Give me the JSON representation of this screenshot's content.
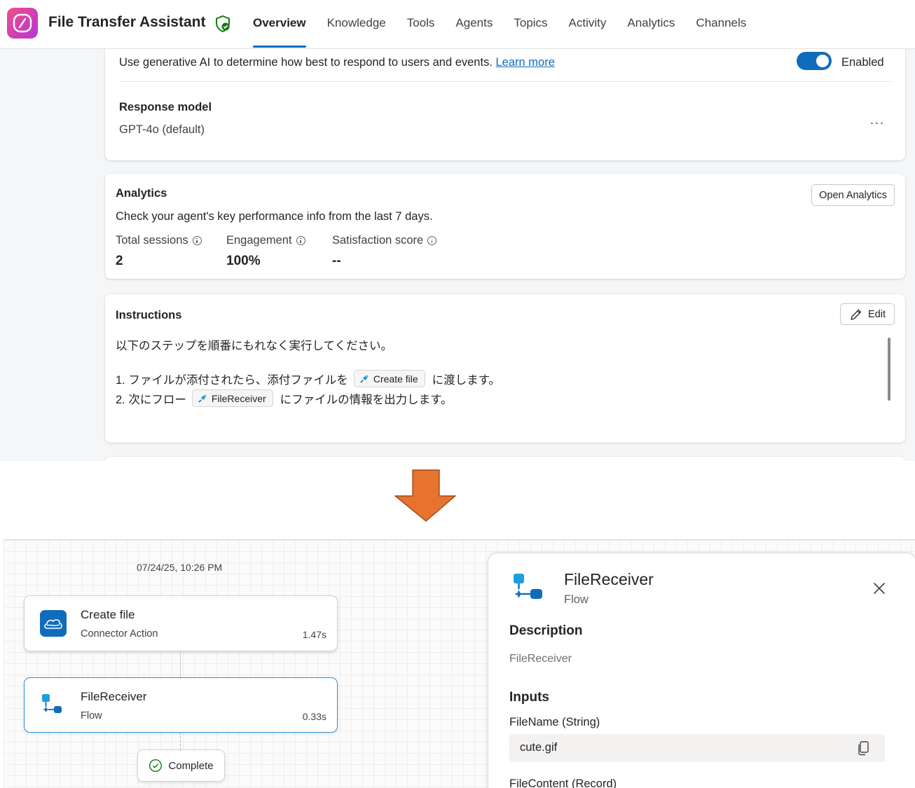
{
  "header": {
    "app_title": "File Transfer Assistant",
    "tabs": [
      "Overview",
      "Knowledge",
      "Tools",
      "Agents",
      "Topics",
      "Activity",
      "Analytics",
      "Channels"
    ],
    "active_tab": "Overview"
  },
  "generative": {
    "description": "Use generative AI to determine how best to respond to users and events.",
    "learn_more": "Learn more",
    "toggle_label": "Enabled",
    "toggle_on": true
  },
  "response_model": {
    "label": "Response model",
    "value": "GPT-4o (default)",
    "more": "···"
  },
  "analytics": {
    "title": "Analytics",
    "open_button": "Open Analytics",
    "description": "Check your agent's key performance info from the last 7 days.",
    "metrics": [
      {
        "label": "Total sessions",
        "value": "2"
      },
      {
        "label": "Engagement",
        "value": "100%"
      },
      {
        "label": "Satisfaction score",
        "value": "--"
      }
    ]
  },
  "instructions": {
    "title": "Instructions",
    "edit_button": "Edit",
    "intro": "以下のステップを順番にもれなく実行してください。",
    "step1_before": "1. ファイルが添付されたら、添付ファイルを",
    "step1_chip": "Create file",
    "step1_after": "に渡します。",
    "step2_before": "2. 次にフロー",
    "step2_chip": "FileReceiver",
    "step2_after": "にファイルの情報を出力します。"
  },
  "arrow_color": "#e8732f",
  "trace": {
    "timestamp": "07/24/25, 10:26 PM",
    "nodes": [
      {
        "title": "Create file",
        "subtitle": "Connector Action",
        "duration": "1.47s",
        "icon": "onedrive-cloud-icon"
      },
      {
        "title": "FileReceiver",
        "subtitle": "Flow",
        "duration": "0.33s",
        "icon": "flow-icon"
      }
    ],
    "complete_label": "Complete"
  },
  "detail": {
    "title": "FileReceiver",
    "type": "Flow",
    "description_title": "Description",
    "description": "FileReceiver",
    "inputs_title": "Inputs",
    "input1_label": "FileName (String)",
    "input1_value": "cute.gif",
    "input2_label": "FileContent (Record)"
  },
  "colors": {
    "accent": "#0f6cbd",
    "flow_blue": "#0f9bd7",
    "success": "#107c10"
  }
}
